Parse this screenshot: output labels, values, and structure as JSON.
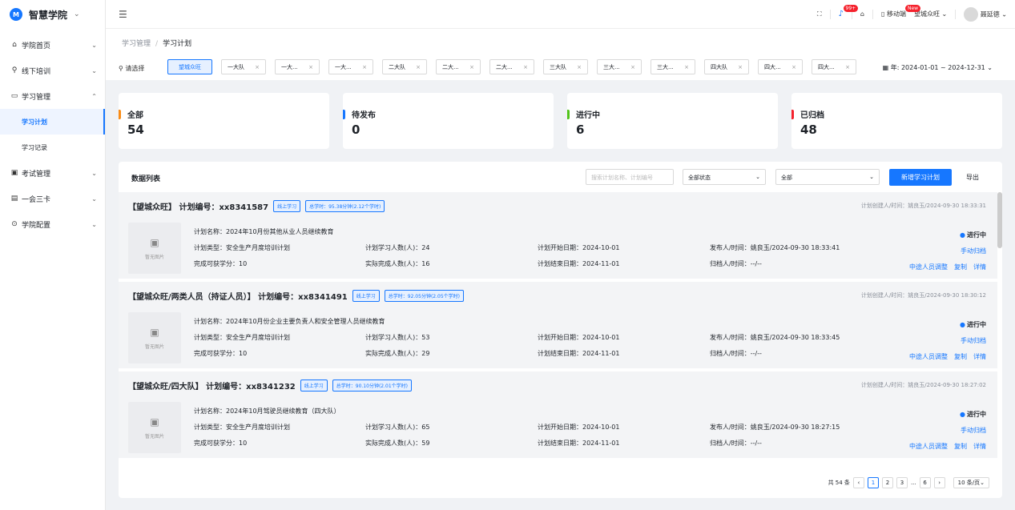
{
  "app": {
    "name": "智慧学院"
  },
  "sidebar": {
    "items": [
      {
        "label": "学院首页",
        "icon": "home-icon",
        "glyph": "⌂",
        "caret": "⌄"
      },
      {
        "label": "线下培训",
        "icon": "user-icon",
        "glyph": "⚲",
        "caret": "⌄"
      },
      {
        "label": "学习管理",
        "icon": "book-icon",
        "glyph": "▭",
        "caret": "⌃"
      },
      {
        "label": "考试管理",
        "icon": "exam-icon",
        "glyph": "▣",
        "caret": "⌄"
      },
      {
        "label": "一会三卡",
        "icon": "card-icon",
        "glyph": "▤",
        "caret": "⌄"
      },
      {
        "label": "学院配置",
        "icon": "settings-icon",
        "glyph": "⊙",
        "caret": "⌄"
      }
    ],
    "sub_items": [
      {
        "label": "学习计划"
      },
      {
        "label": "学习记录"
      }
    ]
  },
  "topbar": {
    "bell_badge": "99+",
    "mobile_label": "移动端",
    "mobile_badge": "New",
    "org": "望城众旺",
    "user": "聂延德"
  },
  "breadcrumb": {
    "parent": "学习管理",
    "current": "学习计划"
  },
  "filter": {
    "choose_label": "请选择",
    "tags": [
      "望城众旺",
      "一大队",
      "一大...",
      "一大...",
      "二大队",
      "二大...",
      "二大...",
      "三大队",
      "三大...",
      "三大...",
      "四大队",
      "四大...",
      "四大..."
    ],
    "date_range": "年: 2024-01-01 ~ 2024-12-31"
  },
  "stats": [
    {
      "label": "全部",
      "value": "54",
      "color": "#fa8c16"
    },
    {
      "label": "待发布",
      "value": "0",
      "color": "#1677ff"
    },
    {
      "label": "进行中",
      "value": "6",
      "color": "#52c41a"
    },
    {
      "label": "已归档",
      "value": "48",
      "color": "#f5222d"
    }
  ],
  "list": {
    "title": "数据列表",
    "search_placeholder": "搜索计划名称、计划编号",
    "status_select": "全部状态",
    "type_select": "全部",
    "new_button": "新增学习计划",
    "export_button": "导出"
  },
  "plans": [
    {
      "title": "【望城众旺】 计划编号：xx8341587",
      "mode": "线上学习",
      "hours": "总学时：95.38分钟(2.12个学时)",
      "creator": "计划创建人/时间：姚良玉/2024-09-30 18:33:31",
      "no_image": "暂无图片",
      "name": "计划名称：2024年10月份其他从业人员继续教育",
      "type": "计划类型：安全生产月度培训计划",
      "credit": "完成可获学分：10",
      "planned": "计划学习人数(人)：24",
      "actual": "实际完成人数(人)：16",
      "start": "计划开始日期：2024-10-01",
      "end": "计划结束日期：2024-11-01",
      "publisher": "发布人/时间：姚良玉/2024-09-30 18:33:41",
      "archiver": "归档人/时间：--/--",
      "status": "进行中",
      "archive_action": "手动归档",
      "actions": [
        "中途人员调整",
        "复制",
        "详情"
      ]
    },
    {
      "title": "【望城众旺/两类人员（持证人员）】 计划编号：xx8341491",
      "mode": "线上学习",
      "hours": "总学时：92.05分钟(2.05个学时)",
      "creator": "计划创建人/时间：姚良玉/2024-09-30 18:30:12",
      "no_image": "暂无图片",
      "name": "计划名称：2024年10月份企业主要负责人和安全管理人员继续教育",
      "type": "计划类型：安全生产月度培训计划",
      "credit": "完成可获学分：10",
      "planned": "计划学习人数(人)：53",
      "actual": "实际完成人数(人)：29",
      "start": "计划开始日期：2024-10-01",
      "end": "计划结束日期：2024-11-01",
      "publisher": "发布人/时间：姚良玉/2024-09-30 18:33:45",
      "archiver": "归档人/时间：--/--",
      "status": "进行中",
      "archive_action": "手动归档",
      "actions": [
        "中途人员调整",
        "复制",
        "详情"
      ]
    },
    {
      "title": "【望城众旺/四大队】 计划编号：xx8341232",
      "mode": "线上学习",
      "hours": "总学时：90.10分钟(2.01个学时)",
      "creator": "计划创建人/时间：姚良玉/2024-09-30 18:27:02",
      "no_image": "暂无图片",
      "name": "计划名称：2024年10月驾驶员继续教育（四大队）",
      "type": "计划类型：安全生产月度培训计划",
      "credit": "完成可获学分：10",
      "planned": "计划学习人数(人)：65",
      "actual": "实际完成人数(人)：59",
      "start": "计划开始日期：2024-10-01",
      "end": "计划结束日期：2024-11-01",
      "publisher": "发布人/时间：姚良玉/2024-09-30 18:27:15",
      "archiver": "归档人/时间：--/--",
      "status": "进行中",
      "archive_action": "手动归档",
      "actions": [
        "中途人员调整",
        "复制",
        "详情"
      ]
    }
  ],
  "pagination": {
    "total": "共 54 条",
    "pages": [
      "1",
      "2",
      "3",
      "...",
      "6"
    ],
    "current": "1",
    "page_size": "10 条/页"
  }
}
